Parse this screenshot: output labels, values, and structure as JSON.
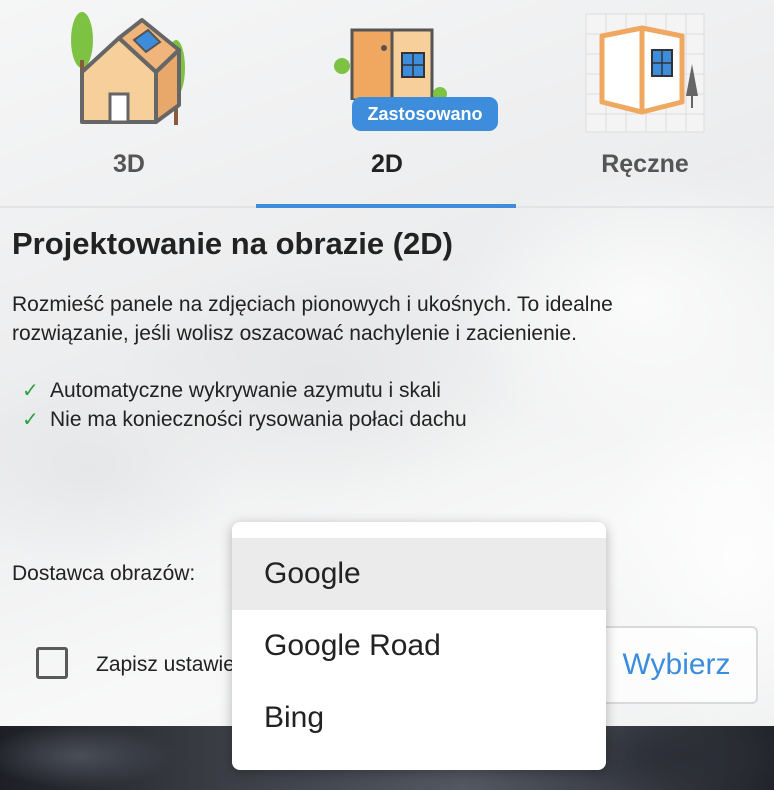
{
  "tabs": [
    {
      "label": "3D",
      "icon": "house-3d-icon"
    },
    {
      "label": "2D",
      "icon": "door-window-2d-icon"
    },
    {
      "label": "Ręczne",
      "icon": "folded-plan-manual-icon"
    }
  ],
  "active_tab": "2D",
  "badge": "Zastosowano",
  "title": "Projektowanie na obrazie (2D)",
  "description": "Rozmieść panele na zdjęciach pionowych i ukośnych. To idealne rozwiązanie, jeśli wolisz oszacować nachylenie i zacienienie.",
  "features": [
    "Automatyczne wykrywanie azymutu i skali",
    "Nie ma konieczności rysowania połaci dachu"
  ],
  "provider": {
    "label": "Dostawca obrazów:",
    "options": [
      "Google",
      "Google Road",
      "Bing"
    ],
    "selected": "Google"
  },
  "save_settings_label": "Zapisz ustawienia",
  "choose_button": "Wybierz",
  "colors": {
    "accent": "#3d8ddc",
    "check": "#2ea043"
  }
}
